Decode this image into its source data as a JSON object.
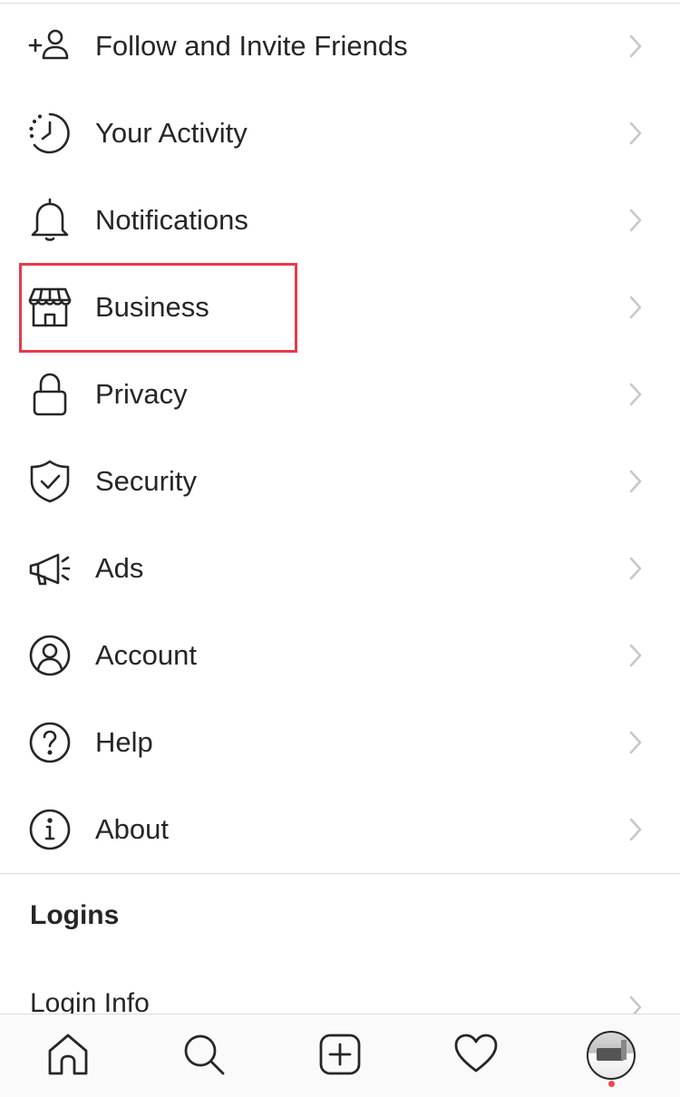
{
  "menu": {
    "items": [
      {
        "label": "Follow and Invite Friends",
        "icon": "add-person-icon"
      },
      {
        "label": "Your Activity",
        "icon": "activity-clock-icon"
      },
      {
        "label": "Notifications",
        "icon": "bell-icon"
      },
      {
        "label": "Business",
        "icon": "storefront-icon"
      },
      {
        "label": "Privacy",
        "icon": "lock-icon"
      },
      {
        "label": "Security",
        "icon": "shield-check-icon"
      },
      {
        "label": "Ads",
        "icon": "megaphone-icon"
      },
      {
        "label": "Account",
        "icon": "user-circle-icon"
      },
      {
        "label": "Help",
        "icon": "question-circle-icon"
      },
      {
        "label": "About",
        "icon": "info-circle-icon"
      }
    ]
  },
  "highlight": {
    "target": "Business",
    "color": "#e8394a"
  },
  "logins": {
    "section_title": "Logins",
    "login_info_label": "Login Info"
  },
  "tab_bar": {
    "tabs": [
      "home-icon",
      "search-icon",
      "new-post-icon",
      "activity-heart-icon",
      "profile-avatar"
    ],
    "notification_dot_color": "#ed4956"
  },
  "colors": {
    "text": "#262626",
    "divider": "#dbdbdb",
    "chevron": "#c7c7cc"
  }
}
